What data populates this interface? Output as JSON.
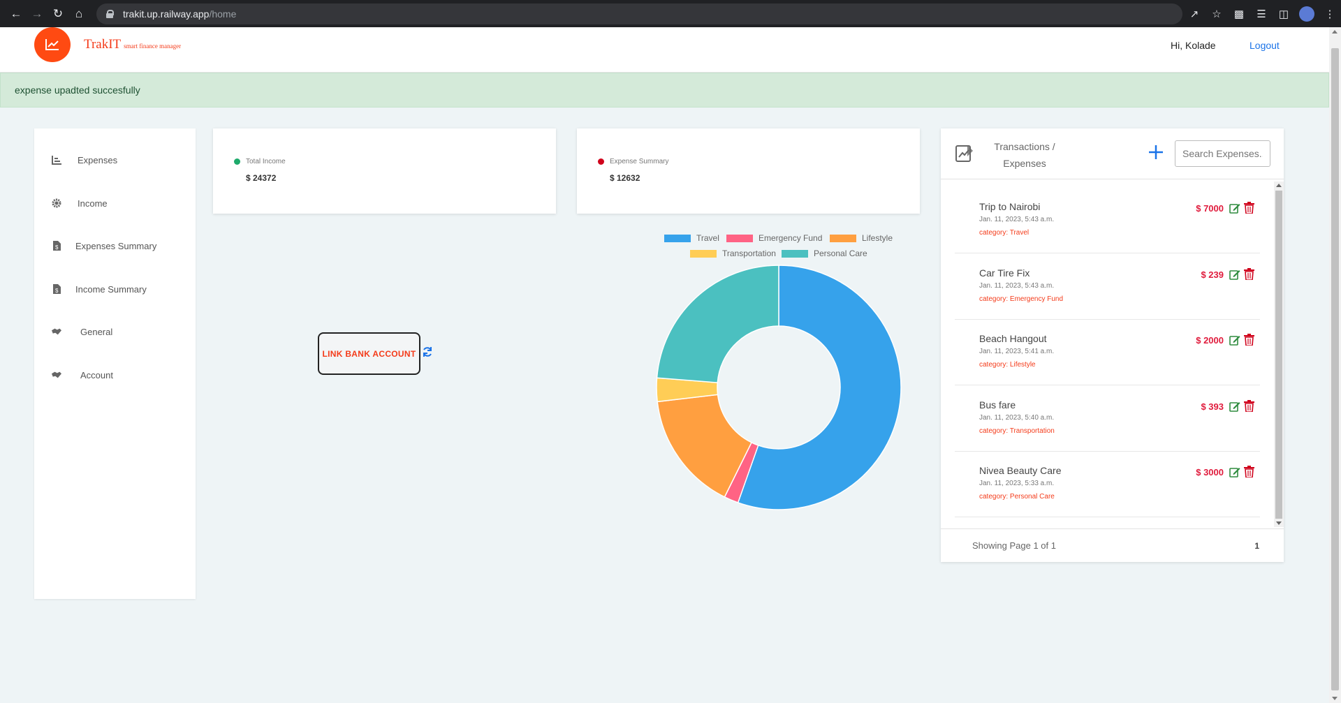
{
  "browser": {
    "url_host": "trakit.up.railway.app",
    "url_path": "/home"
  },
  "header": {
    "brand": "TrakIT",
    "tagline": "smart finance manager",
    "greeting": "Hi, Kolade",
    "logout_label": "Logout"
  },
  "alert": {
    "message": "expense upadted succesfully",
    "color": "#d4ead9"
  },
  "sidebar": {
    "items": [
      {
        "label": "Expenses",
        "icon": "bar-chart-icon"
      },
      {
        "label": "Income",
        "icon": "gear-icon"
      },
      {
        "label": "Expenses Summary",
        "icon": "file-dollar-icon"
      },
      {
        "label": "Income Summary",
        "icon": "file-dollar-icon"
      },
      {
        "label": "General",
        "icon": "handshake-icon"
      },
      {
        "label": "Account",
        "icon": "handshake-icon"
      }
    ]
  },
  "cards": {
    "income": {
      "title": "Total Income",
      "value": "$ 24372",
      "dot_color": "#1eaa6b"
    },
    "expense": {
      "title": "Expense Summary",
      "value": "$ 12632",
      "dot_color": "#d0021b"
    }
  },
  "link_bank": {
    "label": "LINK BANK ACCOUNT"
  },
  "chart_data": {
    "type": "pie",
    "donut": true,
    "categories": [
      "Travel",
      "Emergency Fund",
      "Lifestyle",
      "Transportation",
      "Personal Care"
    ],
    "values": [
      7000,
      239,
      2000,
      393,
      3000
    ],
    "colors": [
      "#36a2eb",
      "#ff6384",
      "#ff9f40",
      "#ffcd56",
      "#4bc0c0"
    ],
    "legend_position": "top"
  },
  "transactions": {
    "title": "Transactions / Expenses",
    "search_placeholder": "Search Expenses...",
    "items": [
      {
        "name": "Trip to Nairobi",
        "date": "Jan. 11, 2023, 5:43 a.m.",
        "category": "category: Travel",
        "amount": "$ 7000"
      },
      {
        "name": "Car Tire Fix",
        "date": "Jan. 11, 2023, 5:43 a.m.",
        "category": "category: Emergency Fund",
        "amount": "$ 239"
      },
      {
        "name": "Beach Hangout",
        "date": "Jan. 11, 2023, 5:41 a.m.",
        "category": "category: Lifestyle",
        "amount": "$ 2000"
      },
      {
        "name": "Bus fare",
        "date": "Jan. 11, 2023, 5:40 a.m.",
        "category": "category: Transportation",
        "amount": "$ 393"
      },
      {
        "name": "Nivea Beauty Care",
        "date": "Jan. 11, 2023, 5:33 a.m.",
        "category": "category: Personal Care",
        "amount": "$ 3000"
      }
    ],
    "pagination": "Showing Page 1 of 1",
    "page_number": "1"
  }
}
